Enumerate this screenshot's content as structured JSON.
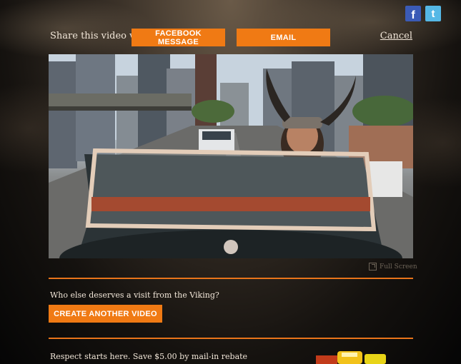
{
  "social": {
    "facebook_icon": "f",
    "twitter_icon": "t"
  },
  "share": {
    "label": "Share this video via",
    "facebook_message": "FACEBOOK MESSAGE",
    "email": "EMAIL",
    "cancel": "Cancel"
  },
  "video": {
    "fullscreen_label": "Full Screen"
  },
  "prompt": {
    "question": "Who else deserves a visit from the Viking?",
    "create_button": "CREATE ANOTHER VIDEO"
  },
  "promo": {
    "text": "Respect starts here. Save $5.00 by mail-in rebate"
  },
  "colors": {
    "accent": "#f07a14",
    "divider": "#e8741a",
    "facebook": "#3b5bb6",
    "twitter": "#55b8e6"
  }
}
